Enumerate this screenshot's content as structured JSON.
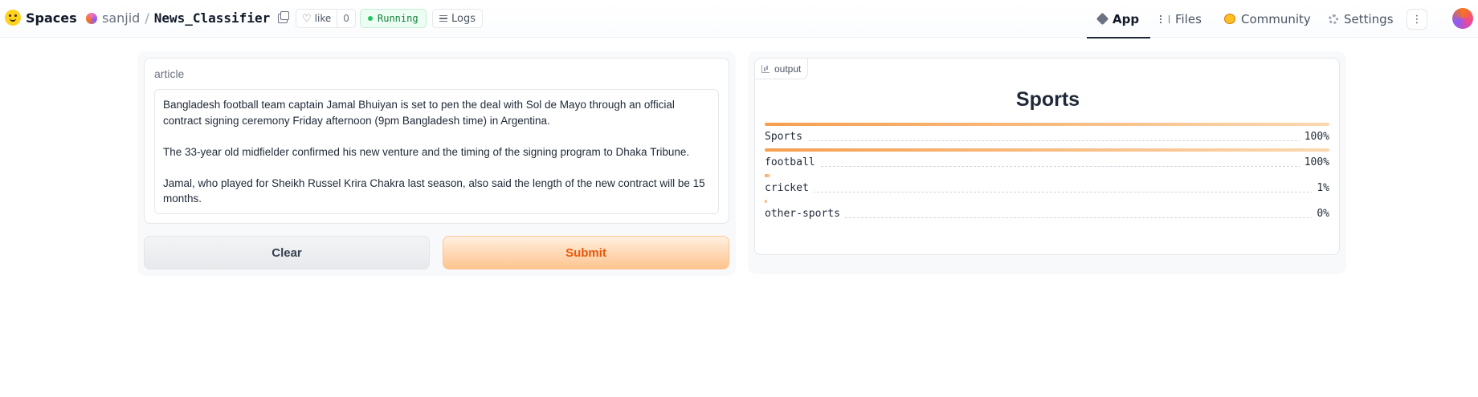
{
  "header": {
    "brand": "Spaces",
    "owner": "sanjid",
    "separator": "/",
    "repo_name": "News_Classifier",
    "like_label": "like",
    "like_count": "0",
    "status": "Running",
    "logs_label": "Logs",
    "nav": [
      {
        "label": "App",
        "icon": "cube-icon",
        "active": true
      },
      {
        "label": "Files",
        "icon": "files-icon",
        "active": false
      },
      {
        "label": "Community",
        "icon": "community-icon",
        "active": false
      },
      {
        "label": "Settings",
        "icon": "gear-icon",
        "active": false
      }
    ],
    "more_label": "⋮"
  },
  "input": {
    "label": "article",
    "text": "Bangladesh football team captain Jamal Bhuiyan is set to pen the deal with Sol de Mayo through an official contract signing ceremony Friday afternoon (9pm Bangladesh time) in Argentina.\n\nThe 33-year old midfielder confirmed his new venture and the timing of the signing program to Dhaka Tribune.\n\nJamal, who played for Sheikh Russel Krira Chakra last season, also said the length of the new contract will be 15 months."
  },
  "buttons": {
    "clear": "Clear",
    "submit": "Submit"
  },
  "output": {
    "tag": "output",
    "title": "Sports",
    "confidences": [
      {
        "label": "Sports",
        "value": "100%",
        "fraction": 1.0
      },
      {
        "label": "football",
        "value": "100%",
        "fraction": 1.0
      },
      {
        "label": "cricket",
        "value": "1%",
        "fraction": 0.01
      },
      {
        "label": "other-sports",
        "value": "0%",
        "fraction": 0.002
      }
    ]
  },
  "colors": {
    "accent": "#ea580c",
    "running": "#15803d",
    "bar_start": "#f59e4f",
    "bar_end": "#fbd8b0"
  }
}
